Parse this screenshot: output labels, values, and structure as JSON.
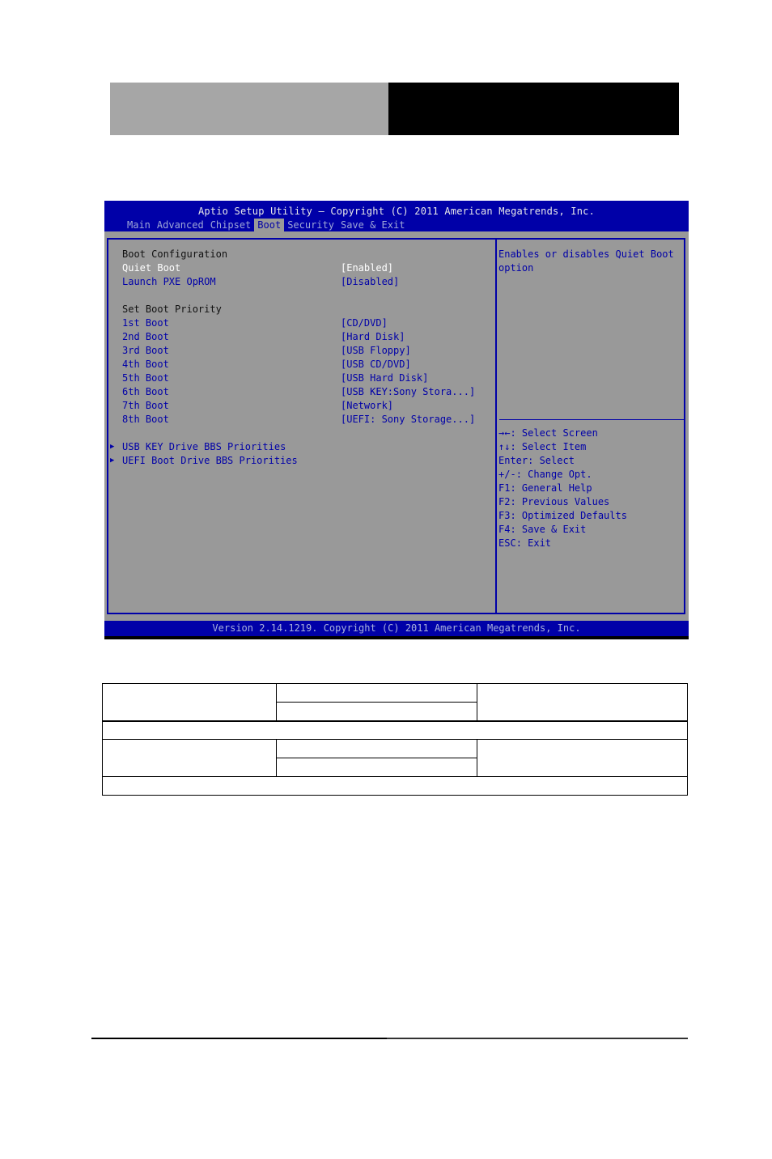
{
  "bios": {
    "title": "Aptio Setup Utility – Copyright (C) 2011 American Megatrends, Inc.",
    "tabs": [
      {
        "label": "Main",
        "active": false
      },
      {
        "label": "Advanced",
        "active": false
      },
      {
        "label": "Chipset",
        "active": false
      },
      {
        "label": "Boot",
        "active": true
      },
      {
        "label": "Security",
        "active": false
      },
      {
        "label": "Save & Exit",
        "active": false
      }
    ],
    "sections": {
      "boot_configuration": "Boot Configuration",
      "set_boot_priority": "Set Boot Priority"
    },
    "settings": [
      {
        "label": "Quiet Boot",
        "value": "[Enabled]",
        "selected": true
      },
      {
        "label": "Launch PXE OpROM",
        "value": "[Disabled]",
        "selected": false
      }
    ],
    "boot_order": [
      {
        "label": "1st Boot",
        "value": "[CD/DVD]"
      },
      {
        "label": "2nd Boot",
        "value": "[Hard Disk]"
      },
      {
        "label": "3rd Boot",
        "value": "[USB Floppy]"
      },
      {
        "label": "4th Boot",
        "value": "[USB CD/DVD]"
      },
      {
        "label": "5th Boot",
        "value": "[USB Hard Disk]"
      },
      {
        "label": "6th Boot",
        "value": "[USB KEY:Sony Stora...]"
      },
      {
        "label": "7th Boot",
        "value": "[Network]"
      },
      {
        "label": "8th Boot",
        "value": "[UEFI: Sony Storage...]"
      }
    ],
    "submenus": [
      {
        "label": "USB KEY Drive BBS Priorities"
      },
      {
        "label": "UEFI Boot Drive BBS Priorities"
      }
    ],
    "help_text": [
      "Enables or disables Quiet Boot",
      "option"
    ],
    "key_help": [
      {
        "key": "→←",
        "action": ": Select Screen"
      },
      {
        "key": "↑↓",
        "action": ": Select Item"
      },
      {
        "key": "Enter",
        "action": ": Select"
      },
      {
        "key": "+/-",
        "action": ": Change Opt."
      },
      {
        "key": "F1",
        "action": ": General Help"
      },
      {
        "key": "F2",
        "action": ": Previous Values"
      },
      {
        "key": "F3",
        "action": ": Optimized Defaults"
      },
      {
        "key": "F4",
        "action": ": Save & Exit"
      },
      {
        "key": "ESC",
        "action": ": Exit"
      }
    ],
    "footer": "Version 2.14.1219. Copyright (C) 2011 American Megatrends, Inc.",
    "colors": {
      "blue": "#0000a8",
      "panel_gray": "#999999",
      "selected_text": "#ffffff"
    }
  }
}
